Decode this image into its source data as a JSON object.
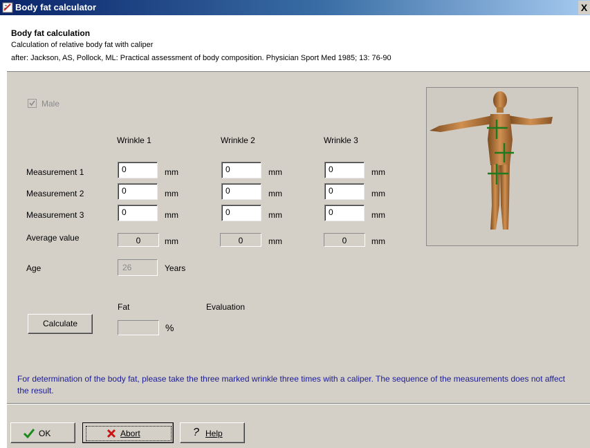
{
  "window": {
    "title": "Body fat calculator",
    "close": "X"
  },
  "header": {
    "title": "Body fat calculation",
    "subtitle": "Calculation of relative body fat with caliper",
    "reference": "after: Jackson, AS, Pollock, ML: Practical assessment of body composition. Physician Sport Med 1985; 13: 76-90"
  },
  "form": {
    "male_label": "Male",
    "male_checked": true,
    "columns": [
      "Wrinkle 1",
      "Wrinkle 2",
      "Wrinkle 3"
    ],
    "rows": [
      "Measurement 1",
      "Measurement 2",
      "Measurement 3"
    ],
    "values": [
      [
        "0",
        "0",
        "0"
      ],
      [
        "0",
        "0",
        "0"
      ],
      [
        "0",
        "0",
        "0"
      ]
    ],
    "unit": "mm",
    "average_label": "Average value",
    "averages": [
      "0",
      "0",
      "0"
    ],
    "age_label": "Age",
    "age_value": "26",
    "age_unit": "Years",
    "fat_label": "Fat",
    "evaluation_label": "Evaluation",
    "fat_value": "",
    "fat_unit": "%",
    "calculate_label": "Calculate"
  },
  "info_text": "For determination of the body fat, please take the three marked wrinkle three times with a caliper. The sequence of the measurements does not affect the result.",
  "buttons": {
    "ok": "OK",
    "abort": "Abort",
    "help": "Help"
  },
  "colors": {
    "info": "#1b1b93",
    "panel": "#d4d0c8",
    "marker": "#1e7a1e"
  }
}
